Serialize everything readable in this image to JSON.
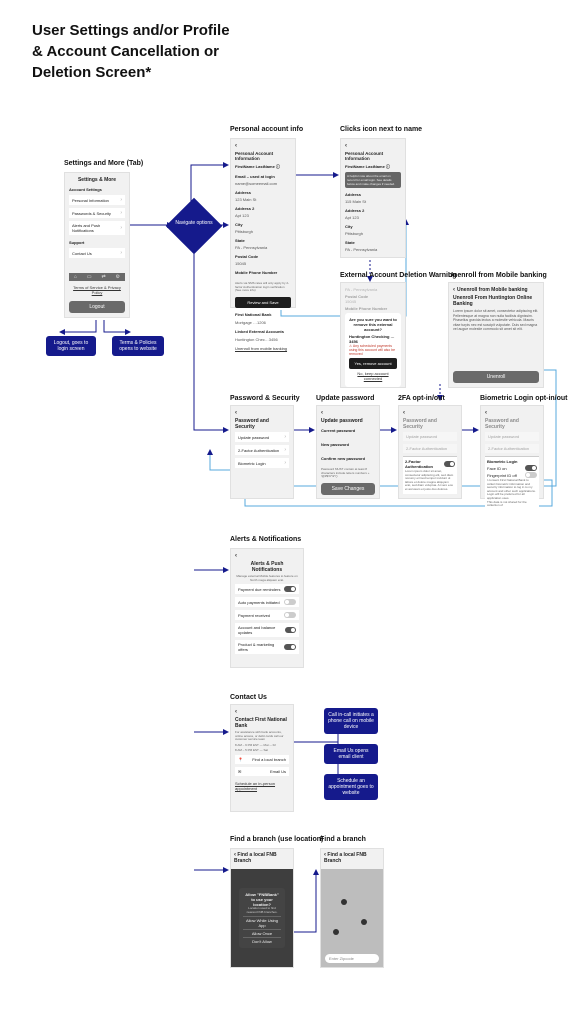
{
  "page_title_line1": "User Settings and/or Profile",
  "page_title_line2": "& Account Cancellation or",
  "page_title_line3": "Deletion Screen*",
  "sections": {
    "settings_tab": "Settings and More (Tab)",
    "personal_info": "Personal account info",
    "click_icon": "Clicks icon next to name",
    "ext_deletion": "External Account Deletion Warning",
    "unenroll": "Unenroll from Mobile banking",
    "pw_security": "Password & Security",
    "update_pw": "Update password",
    "twofa": "2FA opt-in/out",
    "biometric": "Biometric Login opt-in/out",
    "alerts": "Alerts & Notifications",
    "contact": "Contact Us",
    "find_branch_loc": "Find a branch (use location)",
    "find_branch": "Find a branch"
  },
  "diamond": {
    "label": "Navigate options"
  },
  "settings_screen": {
    "title": "Settings & More",
    "group1": "Account Settings",
    "items": [
      "Personal Information",
      "Passwords & Security",
      "Alerts and Push Notifications"
    ],
    "group2": "Support",
    "support_item": "Contact Us",
    "footer": "Terms of Service & Privacy Policy",
    "logout": "Logout"
  },
  "callouts": {
    "logout": "Logout, goes to login screen",
    "terms": "Terms & Policies opens to website",
    "call": "Call in-call initiates a phone call on mobile device",
    "email": "Email Us opens email client",
    "schedule": "Schedule an appointment goes to website"
  },
  "personal": {
    "title": "Personal Account Information",
    "name": "FirstName LastName",
    "email_label": "Email – used at login",
    "email_val": "name@someemail.com",
    "addr_label": "Address",
    "addr_val": "123 Main St",
    "addr2_label": "Address 2",
    "addr2_val": "Apt 123",
    "city_label": "City",
    "city_val": "Pittsburgh",
    "state_label": "State",
    "state_val": "PA - Pennsylvania",
    "postal_label": "Postal Code",
    "postal_val": "15045",
    "phone_label": "Mobile Phone Number",
    "note": "Alerts via SMS rates will only apply by 2-factor Authentication login verification (See more info)",
    "save_btn": "Review and Save",
    "bank_hdr": "First National Bank",
    "mortgage": "Mortgage …1206",
    "linked_hdr": "Linked External Accounts",
    "linked_val": "Huntington Chec…3456",
    "unenroll_link": "Unenroll from mobile banking"
  },
  "click_icon_screen": {
    "tooltip": "A helpful note about the email on record for email login. See details below and make changes if needed.",
    "addr_val": "115 Main St"
  },
  "deletion_modal": {
    "account": "Huntington Checking …3456",
    "question": "Are you sure you want to remove this external account?",
    "warn": "Any scheduled payments using this account will also be removed",
    "yes": "Yes, remove account",
    "no": "No, keep account connected"
  },
  "unenroll_screen": {
    "title": "Unenroll From Huntington Online Banking",
    "body": "Lorem ipsum dolor sit amet, consectetur adipiscing elit. Pellentesque at magna non nulla facilisis dignissim. Phasellus gravida lectus a molestie vehicula. Mauris vitae turpis nec est suscipit vulputate. Duis sed magna vel augue molestie commodo sit amet sit elit.",
    "btn": "Unenroll"
  },
  "pwsec": {
    "title": "Password and Security",
    "items": [
      "Update password",
      "2-Factor Authentication",
      "Biometric Login"
    ]
  },
  "updatepw": {
    "title": "Update password",
    "cur": "Current password",
    "new": "New password",
    "confirm": "Confirm new password",
    "rules": "Password MUST contain at least 8 characters include letters numbers + !@#$%^&*()",
    "btn": "Save Changes"
  },
  "twofa_screen": {
    "item": "2-Factor Authentication",
    "body": "Lorem ipsum dolor sit amet, consectetur adipiscing elit, sed diam nonumy eirmod tempor invidunt ut labore et dolore magna aliquyam erat, sed diam voluptua. At vero eos et accusam et justo duo dolores."
  },
  "bio_screen": {
    "item": "Biometric Login",
    "face": "Face ID on",
    "finger": "Fingerprint ID off",
    "body": "I consent First National Bank to collect biometric information and security information to log in to my account and other such applications. Login will be preferred for all application uses.",
    "note": "This data is not shared for the collection of"
  },
  "alerts_screen": {
    "title": "Alerts & Push Notifications",
    "sub": "Manage external Mobile features to feature on North mega aliquam erat.",
    "items": [
      "Payment due reminders",
      "Auto payments initiated",
      "Payment received",
      "Account and balance updates",
      "Product & marketing offers"
    ]
  },
  "contact_screen": {
    "title": "Contact First National Bank",
    "sub": "For assistance with bank accounts, online access, or debit cards call our customer service team",
    "hours1": "8 AM – 9 PM EST — Mon – Fri",
    "hours2": "8 AM – 5 PM EST — Sat",
    "find": "Find a local branch",
    "email": "Email Us",
    "schedule": "Schedule an in-person appointment"
  },
  "branch": {
    "title": "Find a local FNB Branch",
    "modal_title": "Allow \"FNBBank\" to use your location?",
    "modal_body": "Location used to find nearest FNB branches.",
    "allow": "Allow While Using App",
    "once": "Allow Once",
    "deny": "Don't Allow",
    "search_placeholder": "Enter Zipcode"
  }
}
